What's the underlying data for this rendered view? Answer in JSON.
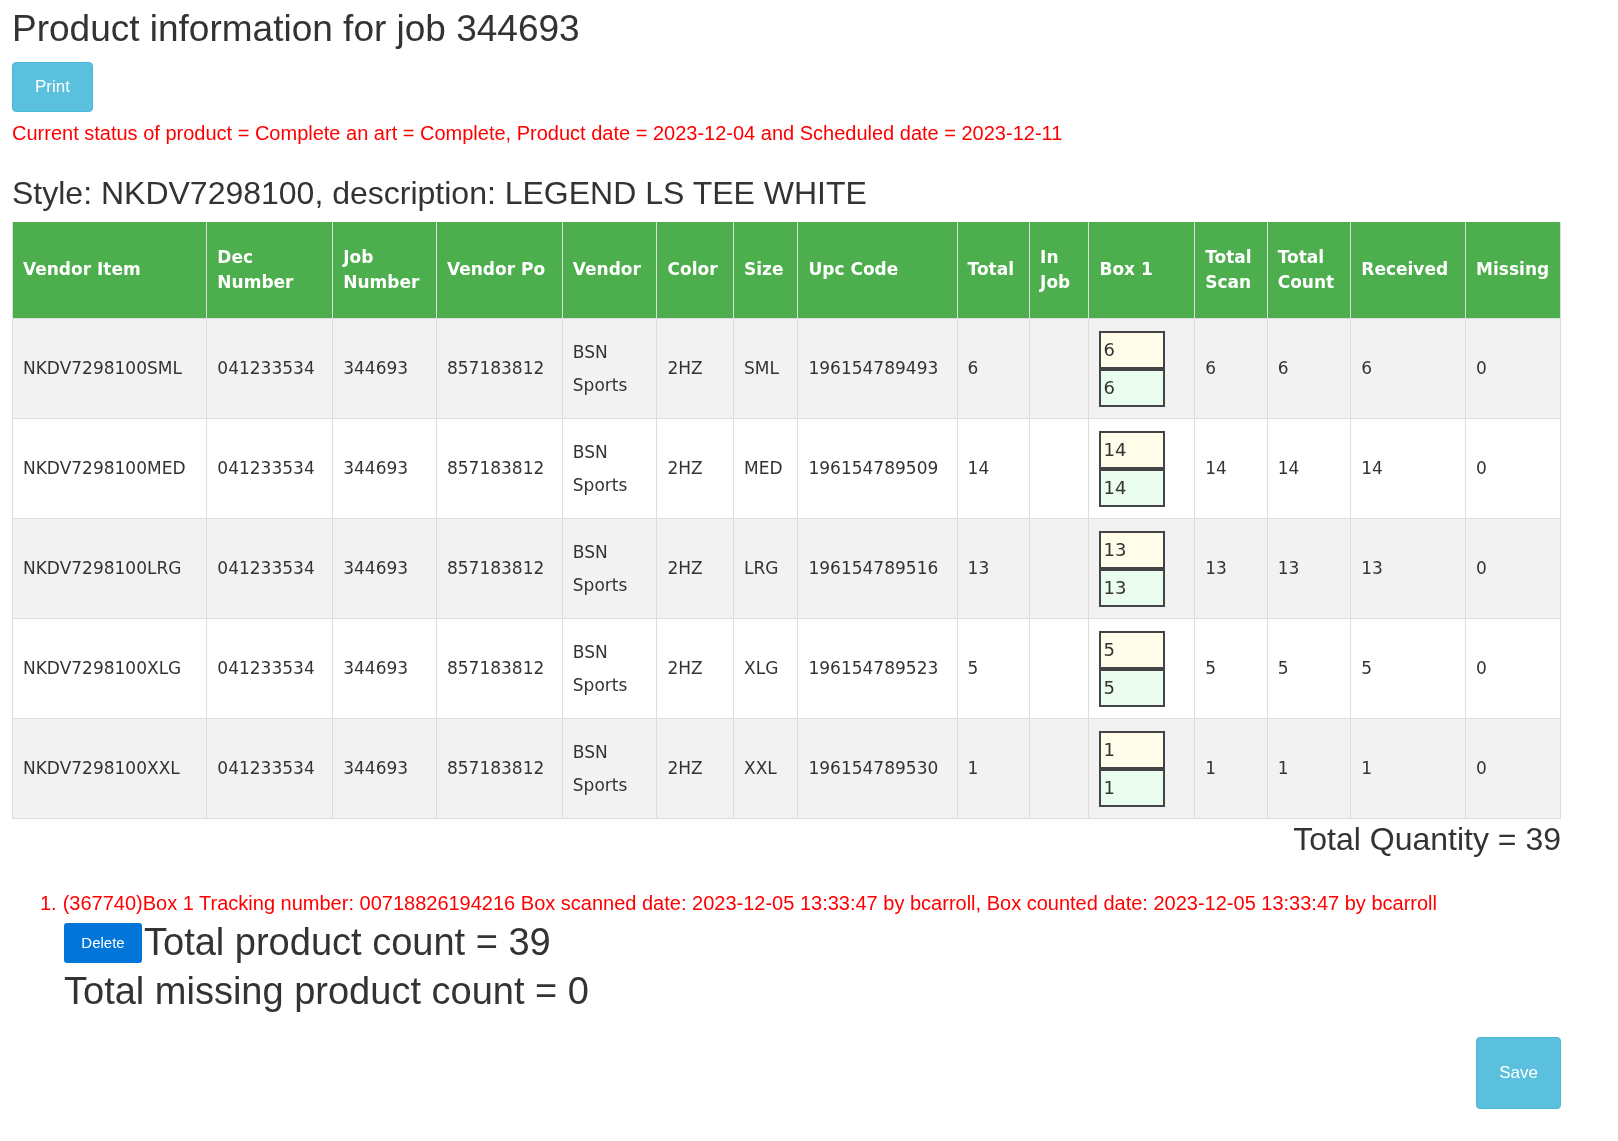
{
  "title": "Product information for job 344693",
  "print_button": "Print",
  "status_message": "Current status of product = Complete an art = Complete, Product date = 2023-12-04 and Scheduled date = 2023-12-11",
  "style_heading": "Style: NKDV7298100, description: LEGEND LS TEE WHITE",
  "table": {
    "columns": [
      "Vendor Item",
      "Dec Number",
      "Job Number",
      "Vendor Po",
      "Vendor",
      "Color",
      "Size",
      "Upc Code",
      "Total",
      "In Job",
      "Box 1",
      "Total Scan",
      "Total Count",
      "Received",
      "Missing"
    ],
    "rows": [
      {
        "vendor_item": "NKDV7298100SML",
        "dec_number": "041233534",
        "job_number": "344693",
        "vendor_po": "857183812",
        "vendor": "BSN Sports",
        "color_code": "2HZ",
        "size": "SML",
        "upc_code": "196154789493",
        "total": "6",
        "box_1_scanned": "6",
        "box_1_counted": "6",
        "total_scan": "6",
        "total_count": "6",
        "received": "6",
        "missing": "0"
      },
      {
        "vendor_item": "NKDV7298100MED",
        "dec_number": "041233534",
        "job_number": "344693",
        "vendor_po": "857183812",
        "vendor": "BSN Sports",
        "color_code": "2HZ",
        "size": "MED",
        "upc_code": "196154789509",
        "total": "14",
        "box_1_scanned": "14",
        "box_1_counted": "14",
        "total_scan": "14",
        "total_count": "14",
        "received": "14",
        "missing": "0"
      },
      {
        "vendor_item": "NKDV7298100LRG",
        "dec_number": "041233534",
        "job_number": "344693",
        "vendor_po": "857183812",
        "vendor": "BSN Sports",
        "color_code": "2HZ",
        "size": "LRG",
        "upc_code": "196154789516",
        "total": "13",
        "box_1_scanned": "13",
        "box_1_counted": "13",
        "total_scan": "13",
        "total_count": "13",
        "received": "13",
        "missing": "0"
      },
      {
        "vendor_item": "NKDV7298100XLG",
        "dec_number": "041233534",
        "job_number": "344693",
        "vendor_po": "857183812",
        "vendor": "BSN Sports",
        "color_code": "2HZ",
        "size": "XLG",
        "upc_code": "196154789523",
        "total": "5",
        "box_1_scanned": "5",
        "box_1_counted": "5",
        "total_scan": "5",
        "total_count": "5",
        "received": "5",
        "missing": "0"
      },
      {
        "vendor_item": "NKDV7298100XXL",
        "dec_number": "041233534",
        "job_number": "344693",
        "vendor_po": "857183812",
        "vendor": "BSN Sports",
        "color_code": "2HZ",
        "size": "XXL",
        "upc_code": "196154789530",
        "total": "1",
        "box_1_scanned": "1",
        "box_1_counted": "1",
        "total_scan": "1",
        "total_count": "1",
        "received": "1",
        "missing": "0"
      }
    ]
  },
  "total_quantity": "Total Quantity = 39",
  "boxes": [
    {
      "number": "1.",
      "text": "(367740)Box 1 Tracking number: 00718826194216 Box scanned date: 2023-12-05 13:33:47 by bcarroll, Box counted date: 2023-12-05 13:33:47 by bcarroll"
    }
  ],
  "delete_button": "Delete",
  "total_product_count": "Total product count = 39",
  "total_missing_count": "Total missing product count = 0",
  "save_button": "Save"
}
